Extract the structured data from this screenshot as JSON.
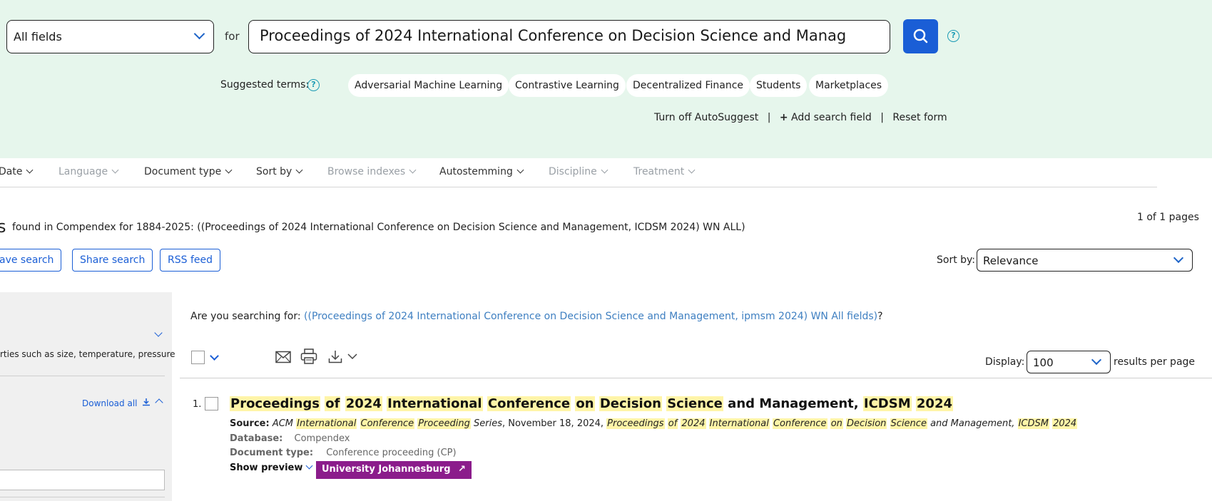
{
  "search": {
    "field_select": "All fields",
    "for_label": "for",
    "query": "Proceedings of 2024 International Conference on Decision Science and Manag",
    "help": "?"
  },
  "suggestions": {
    "label": "Suggested terms:",
    "help": "?",
    "terms": [
      "Adversarial Machine Learning",
      "Contrastive Learning",
      "Decentralized Finance",
      "Students",
      "Marketplaces"
    ]
  },
  "form_links": {
    "autosuggest": "Turn off AutoSuggest",
    "separator": "|",
    "add_field_icon": "+",
    "add_field": "Add search field",
    "reset": "Reset form"
  },
  "filters": [
    {
      "label": "Date",
      "enabled": true
    },
    {
      "label": "Language",
      "enabled": false
    },
    {
      "label": "Document type",
      "enabled": true
    },
    {
      "label": "Sort by",
      "enabled": true
    },
    {
      "label": "Browse indexes",
      "enabled": false
    },
    {
      "label": "Autostemming",
      "enabled": true
    },
    {
      "label": "Discipline",
      "enabled": false
    },
    {
      "label": "Treatment",
      "enabled": false
    }
  ],
  "results_header": {
    "count_fragment": "s",
    "summary": "found in Compendex for 1884-2025: ((Proceedings of 2024 International Conference on Decision Science and Management, ICDSM 2024) WN ALL)",
    "pages": "1 of 1 pages",
    "actions": [
      "ave search",
      "Share search",
      "RSS feed"
    ],
    "sort_label": "Sort by:",
    "sort_value": "Relevance"
  },
  "sidebar": {
    "snippet": "rties such as size, temperature, pressure",
    "download_all": "Download all"
  },
  "did_you_mean": {
    "prefix": "Are you searching for: ",
    "suggestion": "((Proceedings of 2024 International Conference on Decision Science and Management, ipmsm 2024) WN All fields)",
    "suffix": "?"
  },
  "toolbar": {
    "icons": [
      "email-icon",
      "print-icon",
      "download-icon"
    ],
    "display_label": "Display:",
    "display_value": "100",
    "per_page_label": "results per page"
  },
  "result": {
    "number": "1.",
    "title_parts": [
      {
        "t": "Proceedings",
        "h": true
      },
      {
        "t": " ",
        "h": false
      },
      {
        "t": "of",
        "h": true
      },
      {
        "t": " ",
        "h": false
      },
      {
        "t": "2024",
        "h": true
      },
      {
        "t": " ",
        "h": false
      },
      {
        "t": "International",
        "h": true
      },
      {
        "t": " ",
        "h": false
      },
      {
        "t": "Conference",
        "h": true
      },
      {
        "t": " ",
        "h": false
      },
      {
        "t": "on",
        "h": true
      },
      {
        "t": " ",
        "h": false
      },
      {
        "t": "Decision",
        "h": true
      },
      {
        "t": " ",
        "h": false
      },
      {
        "t": "Science",
        "h": true
      },
      {
        "t": " and Management, ",
        "h": false
      },
      {
        "t": "ICDSM",
        "h": true
      },
      {
        "t": " ",
        "h": false
      },
      {
        "t": "2024",
        "h": true
      }
    ],
    "source_label": "Source:",
    "source_parts": [
      {
        "t": "ACM ",
        "h": false,
        "i": true
      },
      {
        "t": "International",
        "h": true,
        "i": true
      },
      {
        "t": " ",
        "h": false,
        "i": true
      },
      {
        "t": "Conference",
        "h": true,
        "i": true
      },
      {
        "t": " ",
        "h": false,
        "i": true
      },
      {
        "t": "Proceeding",
        "h": true,
        "i": true
      },
      {
        "t": " Series",
        "h": false,
        "i": true
      },
      {
        "t": ", November 18, 2024, ",
        "h": false,
        "i": false
      },
      {
        "t": "Proceedings",
        "h": true,
        "i": true
      },
      {
        "t": " ",
        "h": false,
        "i": true
      },
      {
        "t": "of",
        "h": true,
        "i": true
      },
      {
        "t": " ",
        "h": false,
        "i": true
      },
      {
        "t": "2024",
        "h": true,
        "i": true
      },
      {
        "t": " ",
        "h": false,
        "i": true
      },
      {
        "t": "International",
        "h": true,
        "i": true
      },
      {
        "t": " ",
        "h": false,
        "i": true
      },
      {
        "t": "Conference",
        "h": true,
        "i": true
      },
      {
        "t": " ",
        "h": false,
        "i": true
      },
      {
        "t": "on",
        "h": true,
        "i": true
      },
      {
        "t": " ",
        "h": false,
        "i": true
      },
      {
        "t": "Decision",
        "h": true,
        "i": true
      },
      {
        "t": " ",
        "h": false,
        "i": true
      },
      {
        "t": "Science",
        "h": true,
        "i": true
      },
      {
        "t": " and Management, ",
        "h": false,
        "i": true
      },
      {
        "t": "ICDSM",
        "h": true,
        "i": true
      },
      {
        "t": " ",
        "h": false,
        "i": true
      },
      {
        "t": "2024",
        "h": true,
        "i": true
      }
    ],
    "database_label": "Database:",
    "database": "Compendex",
    "doctype_label": "Document type:",
    "doctype": "Conference proceeding (CP)",
    "show_preview": "Show preview",
    "university_badge": "University Johannesburg",
    "badge_arrow": "↗"
  },
  "colors": {
    "panel_bg": "#e6f6ec",
    "accent_blue": "#1a5ed6",
    "highlight": "#fff5a8",
    "badge_purple": "#8b1c8b"
  }
}
